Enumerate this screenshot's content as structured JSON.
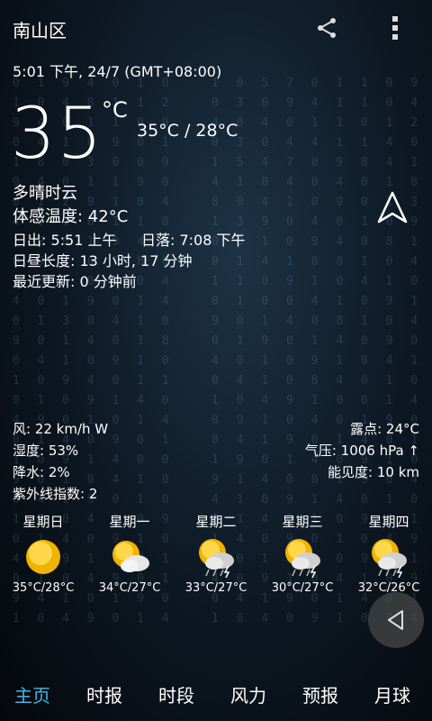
{
  "header": {
    "location": "南山区",
    "share_icon": "share-icon",
    "menu_icon": "more-vert-icon"
  },
  "current": {
    "datetime": "5:01 下午, 24/7 (GMT+08:00)",
    "temperature": "35",
    "unit": "°C",
    "high_low": "35°C / 28°C",
    "condition": "多晴时云",
    "feels_like": "体感温度: 42°C",
    "sunrise": "日出: 5:51 上午",
    "sunset": "日落: 7:08 下午",
    "day_length": "日昼长度: 13 小时, 17 分钟",
    "last_update": "最近更新: 0 分钟前"
  },
  "details": {
    "wind": "风: 22 km/h W",
    "humidity": "湿度: 53%",
    "precipitation": "降水: 2%",
    "uv_index": "紫外线指数: 2",
    "dew_point": "露点: 24°C",
    "pressure": "气压: 1006 hPa ↑",
    "visibility": "能见度: 10 km"
  },
  "forecast": [
    {
      "day": "星期日",
      "range": "35°C/28°C",
      "icon": "sunny-icon"
    },
    {
      "day": "星期一",
      "range": "34°C/27°C",
      "icon": "partly-cloudy-icon"
    },
    {
      "day": "星期二",
      "range": "33°C/27°C",
      "icon": "thunderstorm-sun-icon"
    },
    {
      "day": "星期三",
      "range": "30°C/27°C",
      "icon": "thunderstorm-sun-icon"
    },
    {
      "day": "星期四",
      "range": "32°C/26°C",
      "icon": "thunderstorm-sun-icon"
    }
  ],
  "tabs": [
    {
      "label": "主页",
      "active": true
    },
    {
      "label": "时报",
      "active": false
    },
    {
      "label": "时段",
      "active": false
    },
    {
      "label": "风力",
      "active": false
    },
    {
      "label": "预报",
      "active": false
    },
    {
      "label": "月球",
      "active": false
    }
  ],
  "colors": {
    "accent": "#45b3e6",
    "background": "#0d1722"
  }
}
